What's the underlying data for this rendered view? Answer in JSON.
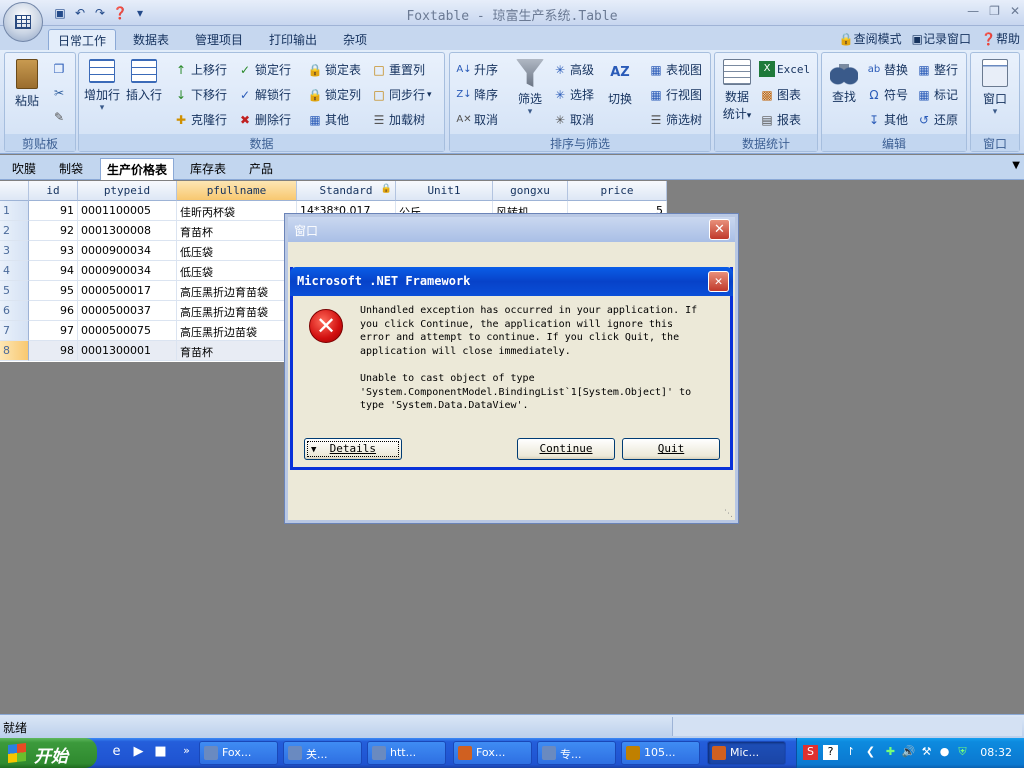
{
  "app": {
    "title": "Foxtable - 琼富生产系统.Table"
  },
  "ribbon_tabs": [
    "日常工作",
    "数据表",
    "管理项目",
    "打印输出",
    "杂项"
  ],
  "ribbon_right": [
    "查阅模式",
    "记录窗口",
    "帮助"
  ],
  "groups": {
    "clipboard": {
      "label": "剪贴板",
      "paste": "粘贴"
    },
    "data": {
      "label": "数据",
      "add_row": "增加行",
      "insert_row": "插入行",
      "move_up": "上移行",
      "move_down": "下移行",
      "clone_row": "克隆行",
      "lock_row": "锁定行",
      "unlock_row": "解锁行",
      "delete_row": "删除行",
      "lock_table": "锁定表",
      "lock_col": "锁定列",
      "other": "其他",
      "reset_col": "重置列",
      "sync_row": "同步行",
      "load_tree": "加载树"
    },
    "sort": {
      "label": "排序与筛选",
      "asc": "升序",
      "desc": "降序",
      "cancel": "取消",
      "filter": "筛选",
      "advanced": "高级",
      "select": "选择",
      "cancel2": "取消",
      "toggle": "切换",
      "table_view": "表视图",
      "row_view": "行视图",
      "filter_tree": "筛选树"
    },
    "stats": {
      "label": "数据统计",
      "data_stats_1": "数据",
      "data_stats_2": "统计",
      "excel": "Excel",
      "chart": "图表",
      "report": "报表"
    },
    "edit": {
      "label": "编辑",
      "find": "查找",
      "replace": "替换",
      "symbol": "符号",
      "other": "其他",
      "whole_row": "整行",
      "mark": "标记",
      "restore": "还原"
    },
    "window": {
      "label": "窗口",
      "window": "窗口"
    }
  },
  "doc_tabs": [
    "吹膜",
    "制袋",
    "生产价格表",
    "库存表",
    "产品"
  ],
  "grid": {
    "columns": [
      "id",
      "ptypeid",
      "pfullname",
      "Standard",
      "Unit1",
      "gongxu",
      "price"
    ],
    "rows": [
      {
        "n": "1",
        "id": "91",
        "ptypeid": "0001100005",
        "pfullname": "佳昕丙杯袋",
        "standard": "14*38*0.017",
        "unit": "公斤",
        "gongxu": "风转机",
        "price": "5"
      },
      {
        "n": "2",
        "id": "92",
        "ptypeid": "0001300008",
        "pfullname": "育苗杯"
      },
      {
        "n": "3",
        "id": "93",
        "ptypeid": "0000900034",
        "pfullname": "低压袋"
      },
      {
        "n": "4",
        "id": "94",
        "ptypeid": "0000900034",
        "pfullname": "低压袋"
      },
      {
        "n": "5",
        "id": "95",
        "ptypeid": "0000500017",
        "pfullname": "高压黑折边育苗袋"
      },
      {
        "n": "6",
        "id": "96",
        "ptypeid": "0000500037",
        "pfullname": "高压黑折边育苗袋"
      },
      {
        "n": "7",
        "id": "97",
        "ptypeid": "0000500075",
        "pfullname": "高压黑折边苗袋"
      },
      {
        "n": "8",
        "id": "98",
        "ptypeid": "0001300001",
        "pfullname": "育苗杯"
      }
    ]
  },
  "window": {
    "title": "窗口"
  },
  "dialog": {
    "title": "Microsoft .NET Framework",
    "message": [
      "Unhandled exception has occurred in your application. If",
      "you click Continue, the application will ignore this",
      "error and attempt to continue. If you click Quit, the",
      "application will close immediately."
    ],
    "detail": [
      "Unable to cast object of type",
      "'System.ComponentModel.BindingList`1[System.Object]' to",
      "type 'System.Data.DataView'."
    ],
    "details_btn": "Details",
    "continue_btn": "Continue",
    "quit_btn": "Quit"
  },
  "status": {
    "text": "就绪"
  },
  "taskbar": {
    "start": "开始",
    "items": [
      "Fox...",
      "关...",
      "htt...",
      "Fox...",
      "专...",
      "105...",
      "Mic..."
    ],
    "clock": "08:32"
  },
  "colors": {
    "ribbon": "#c9daf2",
    "dialog_title": "#0a5ee8",
    "taskbar": "#245edb",
    "start": "#3c9a3c",
    "error": "#d10f0f"
  }
}
